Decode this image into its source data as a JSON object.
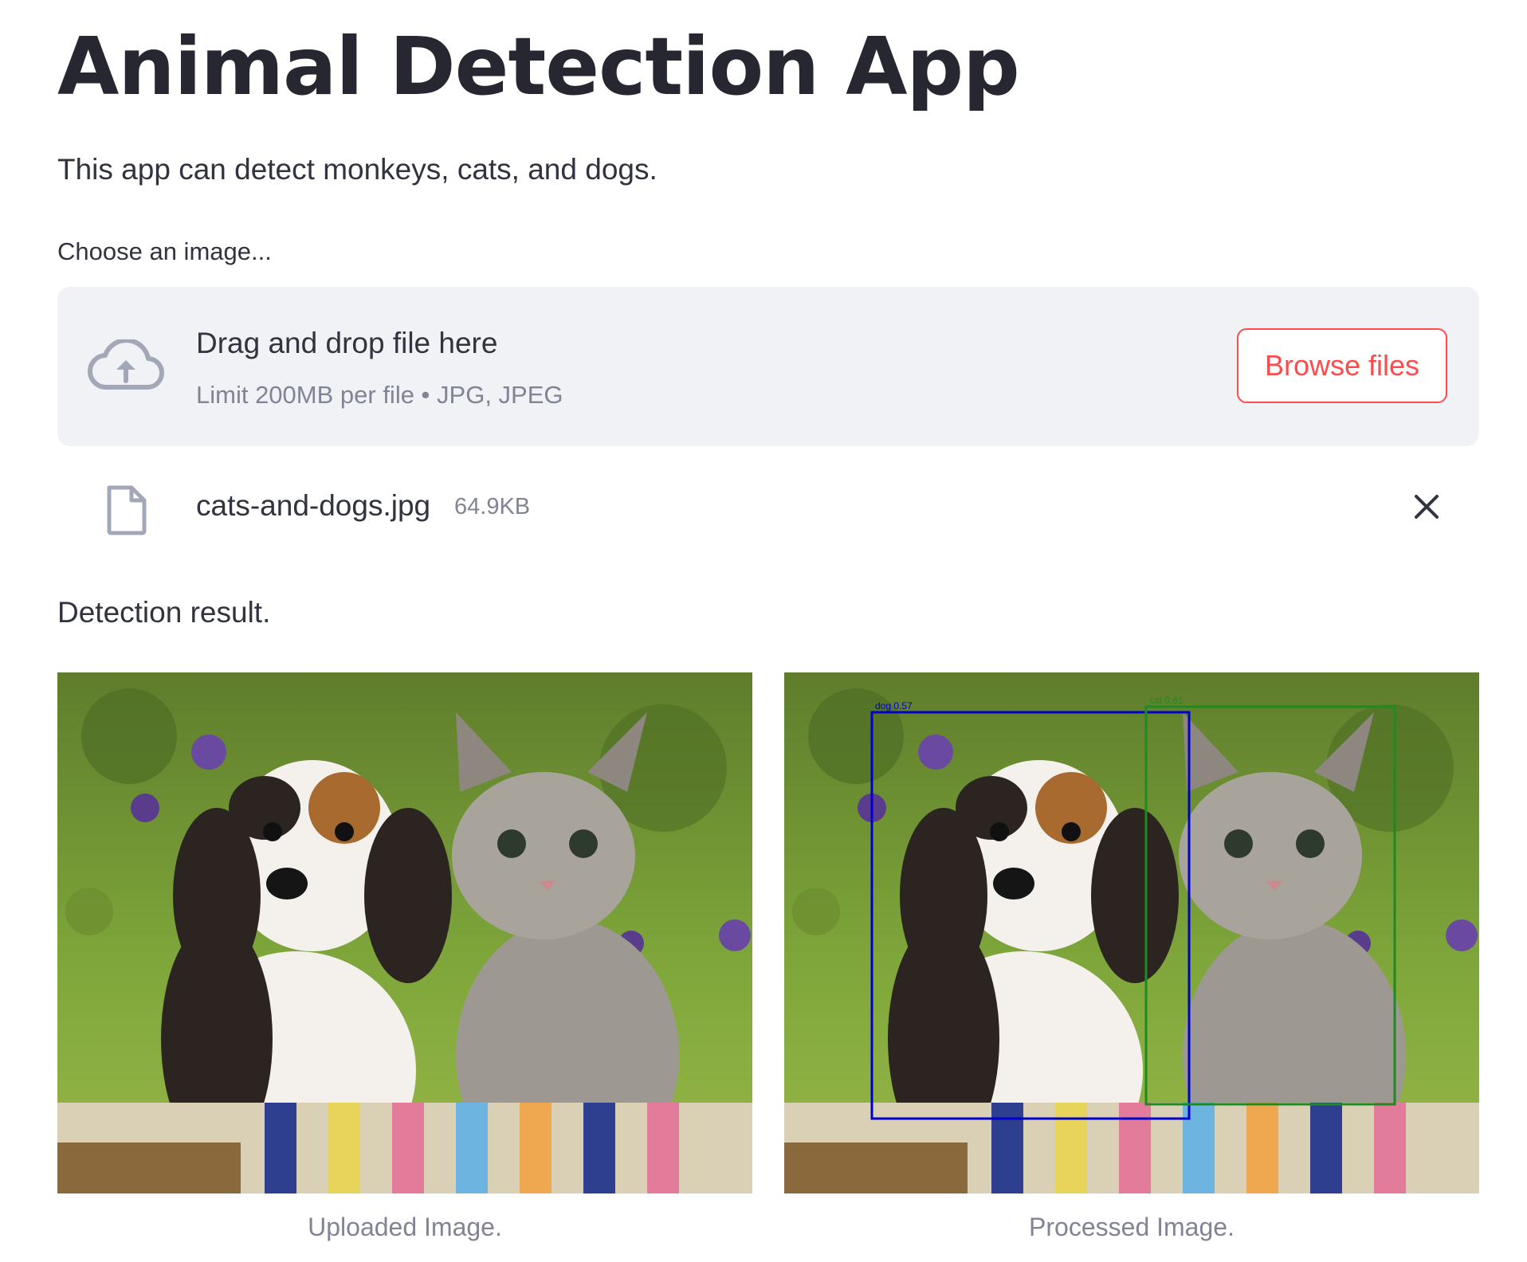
{
  "app": {
    "title": "Animal Detection App",
    "description": "This app can detect monkeys, cats, and dogs."
  },
  "uploader": {
    "label": "Choose an image...",
    "dropzone_text": "Drag and drop file here",
    "limit_text": "Limit 200MB per file • JPG, JPEG",
    "browse_label": "Browse files",
    "icon": "cloud-upload-icon",
    "accent_color": "#ff4b4b"
  },
  "uploaded_file": {
    "name": "cats-and-dogs.jpg",
    "size": "64.9KB",
    "icon": "file-icon",
    "remove_icon": "close-icon"
  },
  "result": {
    "label": "Detection result.",
    "uploaded_caption": "Uploaded Image.",
    "processed_caption": "Processed Image.",
    "detections": [
      {
        "label": "dog 0.57",
        "color": "#0000cc"
      },
      {
        "label": "cat 0.81",
        "color": "#1f8a1f"
      }
    ]
  }
}
